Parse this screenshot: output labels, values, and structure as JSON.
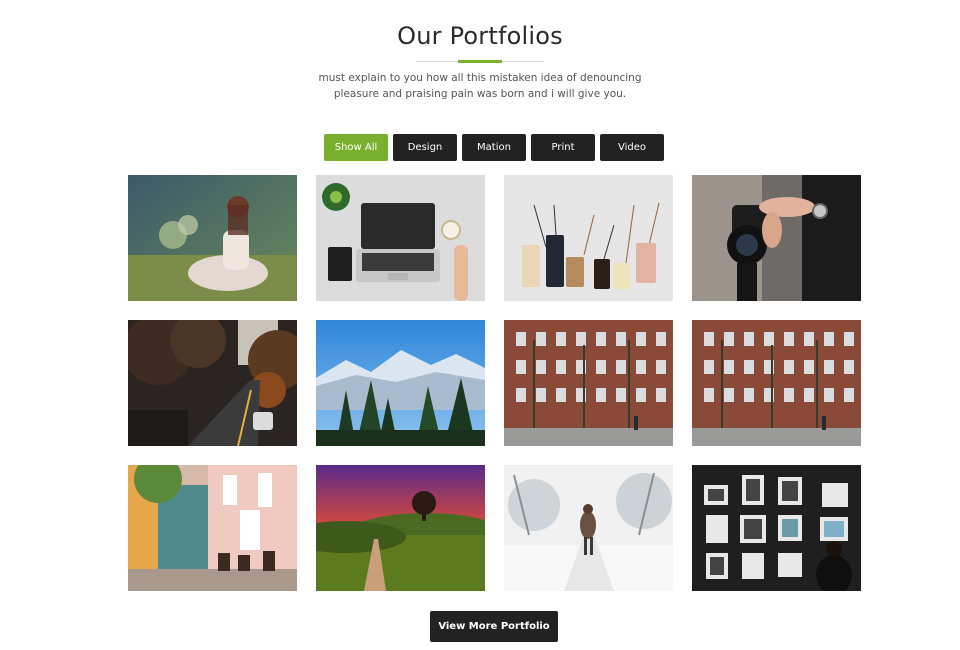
{
  "section": {
    "title": "Our Portfolios",
    "subtitle": "must explain to you how all this mistaken idea of denouncing pleasure and praising pain was born and i will give you."
  },
  "filters": [
    {
      "label": "Show All",
      "active": true
    },
    {
      "label": "Design",
      "active": false
    },
    {
      "label": "Mation",
      "active": false
    },
    {
      "label": "Print",
      "active": false
    },
    {
      "label": "Video",
      "active": false
    }
  ],
  "portfolio_items": [
    {
      "image": "woman-sitting-in-field"
    },
    {
      "image": "laptop-on-desk"
    },
    {
      "image": "price-tags"
    },
    {
      "image": "camera-in-hands"
    },
    {
      "image": "autumn-forest-road"
    },
    {
      "image": "snowy-mountains-pines"
    },
    {
      "image": "brick-building-street"
    },
    {
      "image": "brick-building-street"
    },
    {
      "image": "colorful-street-cafe"
    },
    {
      "image": "sunset-hill-road"
    },
    {
      "image": "snowy-path-person"
    },
    {
      "image": "gallery-wall-photos"
    }
  ],
  "more_button": {
    "label": "View More Portfolio"
  },
  "accent_color": "#79b12f",
  "button_color": "#222222"
}
